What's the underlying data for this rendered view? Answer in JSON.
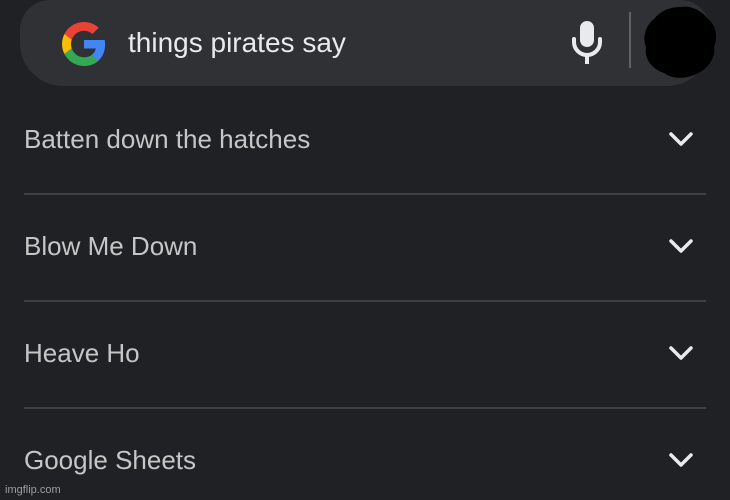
{
  "search": {
    "query": "things pirates say",
    "logo_icon": "google-g-icon",
    "mic_icon": "mic-icon",
    "avatar_icon": "avatar-blacked-out"
  },
  "results": [
    {
      "label": "Batten down the hatches",
      "icon": "chevron-down-icon"
    },
    {
      "label": "Blow Me Down",
      "icon": "chevron-down-icon"
    },
    {
      "label": "Heave Ho",
      "icon": "chevron-down-icon"
    },
    {
      "label": "Google Sheets",
      "icon": "chevron-down-icon"
    }
  ],
  "watermark": "imgflip.com",
  "colors": {
    "background": "#202124",
    "search_bar": "#303134",
    "text": "#e8eaed",
    "result_text": "#c4c7c5",
    "divider": "#3c4043"
  }
}
